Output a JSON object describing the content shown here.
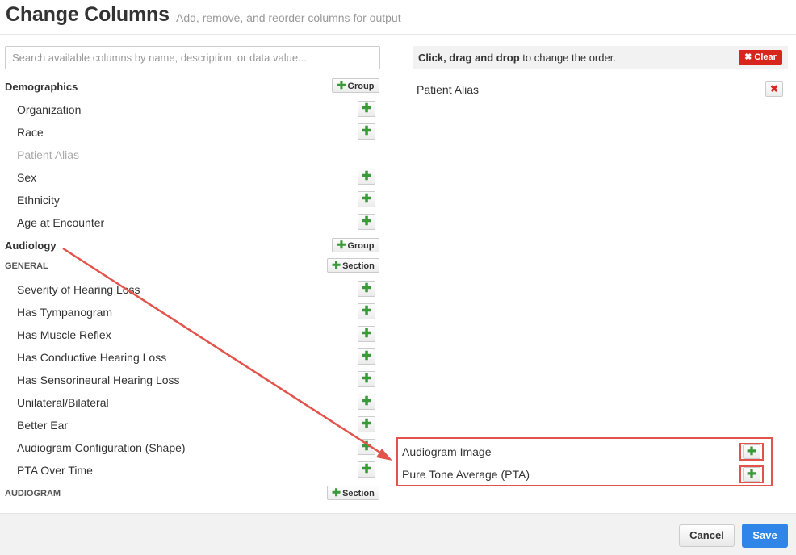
{
  "header": {
    "title": "Change Columns",
    "subtitle": "Add, remove, and reorder columns for output"
  },
  "search": {
    "placeholder": "Search available columns by name, description, or data value..."
  },
  "available": {
    "group_button_label": "Group",
    "section_button_label": "Section",
    "demographics": {
      "title": "Demographics",
      "items": [
        "Organization",
        "Race",
        "Patient Alias",
        "Sex",
        "Ethnicity",
        "Age at Encounter"
      ]
    },
    "audiology": {
      "title": "Audiology",
      "general_section": "GENERAL",
      "general_items": [
        "Severity of Hearing Loss",
        "Has Tympanogram",
        "Has Muscle Reflex",
        "Has Conductive Hearing Loss",
        "Has Sensorineural Hearing Loss",
        "Unilateral/Bilateral",
        "Better Ear",
        "Audiogram Configuration (Shape)",
        "PTA Over Time"
      ],
      "audiogram_section": "AUDIOGRAM"
    }
  },
  "selected": {
    "instruction_bold": "Click, drag and drop",
    "instruction_rest": " to change the order.",
    "clear_label": "Clear",
    "items": [
      "Patient Alias"
    ]
  },
  "callout": {
    "items": [
      "Audiogram Image",
      "Pure Tone Average (PTA)"
    ]
  },
  "footer": {
    "cancel_label": "Cancel",
    "save_label": "Save"
  },
  "colors": {
    "accent_blue": "#2f86e8",
    "danger_red": "#d9261c",
    "plus_green": "#3a9a3a",
    "annotation_red": "#e2534b"
  }
}
